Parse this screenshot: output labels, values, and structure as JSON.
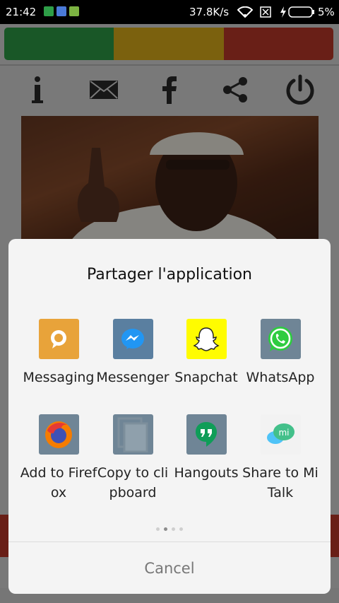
{
  "status_bar": {
    "time": "21:42",
    "network_speed": "37.8K/s",
    "battery": "5%",
    "icons": [
      "notification-icon",
      "play-store-icon",
      "android-icon",
      "wifi-icon",
      "sim-icon",
      "charging-icon",
      "battery-icon"
    ]
  },
  "app": {
    "flag_colors": [
      "#2e9e48",
      "#e0b11a",
      "#c0392b"
    ],
    "toolbar_icons": [
      "info-icon",
      "mail-icon",
      "facebook-icon",
      "share-icon",
      "power-icon"
    ]
  },
  "share_sheet": {
    "title": "Partager  l'application",
    "apps": [
      {
        "label": "Messaging",
        "icon": "messaging-icon",
        "color": "#e8a33a"
      },
      {
        "label": "Messenger",
        "icon": "messenger-icon",
        "color": "#5a7fa0"
      },
      {
        "label": "Snapchat",
        "icon": "snapchat-icon",
        "color": "#fffc00"
      },
      {
        "label": "WhatsApp",
        "icon": "whatsapp-icon",
        "color": "#6f8596"
      },
      {
        "label": "Add to Firefox",
        "icon": "firefox-icon",
        "color": "#6f8596"
      },
      {
        "label": "Copy to clipboard",
        "icon": "clipboard-icon",
        "color": "#6f8596"
      },
      {
        "label": "Hangouts",
        "icon": "hangouts-icon",
        "color": "#6f8596"
      },
      {
        "label": "Share to Mi Talk",
        "icon": "mi-talk-icon",
        "color": "#f2f2f2"
      }
    ],
    "pages": 4,
    "active_page": 2,
    "cancel_label": "Cancel"
  }
}
